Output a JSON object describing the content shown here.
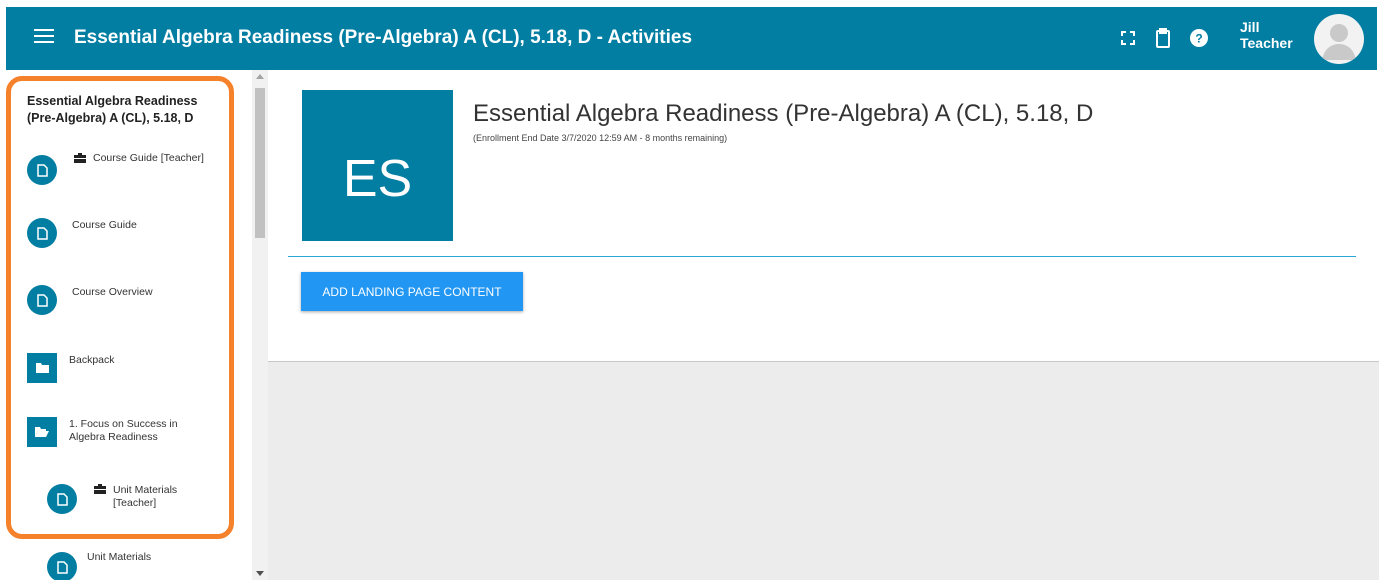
{
  "header": {
    "title": "Essential Algebra Readiness (Pre-Algebra) A (CL), 5.18, D - Activities",
    "user_first": "Jill",
    "user_last": "Teacher",
    "icons": [
      "menu-icon",
      "fullscreen-icon",
      "clipboard-icon",
      "help-icon",
      "avatar"
    ]
  },
  "sidebar": {
    "title": "Essential Algebra Readiness (Pre-Algebra) A (CL), 5.18, D",
    "items": [
      {
        "label": "Course Guide [Teacher]",
        "icon": "document-icon",
        "teacher": true
      },
      {
        "label": "Course Guide",
        "icon": "document-icon"
      },
      {
        "label": "Course Overview",
        "icon": "document-icon"
      },
      {
        "label": "Backpack",
        "icon": "folder-icon"
      },
      {
        "label": "1. Focus on Success in Algebra Readiness",
        "icon": "folder-open-icon"
      },
      {
        "label": "Unit Materials [Teacher]",
        "icon": "document-icon",
        "teacher": true
      },
      {
        "label": "Unit Materials",
        "icon": "document-icon"
      }
    ]
  },
  "main": {
    "logo_text": "ES",
    "course_title": "Essential Algebra Readiness (Pre-Algebra) A (CL), 5.18, D",
    "enrollment": "(Enrollment End Date 3/7/2020 12:59 AM - 8 months remaining)",
    "add_button": "ADD LANDING PAGE CONTENT"
  },
  "colors": {
    "header_bg": "#027ea3",
    "accent": "#027ea3",
    "button": "#2196f3",
    "highlight_outline": "#f5822a"
  }
}
